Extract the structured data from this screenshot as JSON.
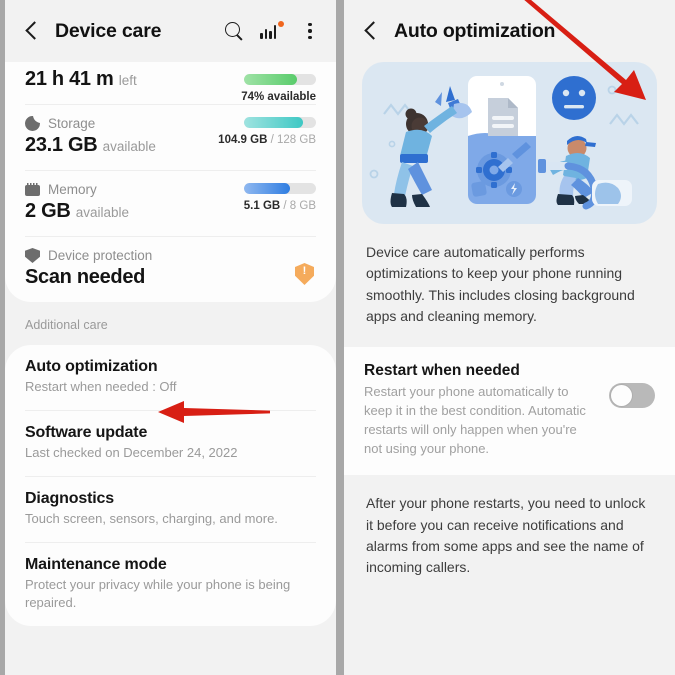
{
  "left_panel": {
    "appbar": {
      "title": "Device care",
      "back_icon": "back-chevron-icon",
      "search_icon": "search-icon",
      "chart_icon": "bar-chart-icon",
      "menu_icon": "more-options-icon"
    },
    "status_rows": [
      {
        "label": "",
        "icon": "battery-icon",
        "value": "21 h 41 m",
        "suffix": "left",
        "meter_text_main": "74% available",
        "meter_text_dim": "",
        "percent": 74,
        "color_from": "#9fe2a6",
        "color_to": "#59cc6b"
      },
      {
        "label": "Storage",
        "icon": "pie-chart-icon",
        "value": "23.1 GB",
        "suffix": "available",
        "meter_text_main": "104.9 GB",
        "meter_text_dim": " / 128 GB",
        "percent": 82,
        "color_from": "#9fe3e0",
        "color_to": "#3ec8c4"
      },
      {
        "label": "Memory",
        "icon": "memory-chip-icon",
        "value": "2 GB",
        "suffix": "available",
        "meter_text_main": "5.1 GB",
        "meter_text_dim": " / 8 GB",
        "percent": 64,
        "color_from": "#8fb8f0",
        "color_to": "#2f7de1"
      },
      {
        "label": "Device protection",
        "icon": "shield-icon",
        "value": "Scan needed",
        "suffix": "",
        "badge_icon": "warning-shield-icon"
      }
    ],
    "section_label": "Additional care",
    "list_rows": [
      {
        "title": "Auto optimization",
        "subtitle": "Restart when needed : Off"
      },
      {
        "title": "Software update",
        "subtitle": "Last checked on December 24, 2022"
      },
      {
        "title": "Diagnostics",
        "subtitle": "Touch screen, sensors, charging, and more."
      },
      {
        "title": "Maintenance mode",
        "subtitle": "Protect your privacy while your phone is being repaired."
      }
    ]
  },
  "right_panel": {
    "appbar": {
      "title": "Auto optimization",
      "back_icon": "back-chevron-icon"
    },
    "illustration": "device-care-optimization-illustration",
    "description": "Device care automatically performs optimizations to keep your phone running smoothly. This includes closing background apps and cleaning memory.",
    "setting": {
      "title": "Restart when needed",
      "description": "Restart your phone automatically to keep it in the best condition. Automatic restarts will only happen when you're not using your phone.",
      "toggle_state": "off"
    },
    "footer": "After your phone restarts, you need to unlock it before you can receive notifications and alarms from some apps and see the name of incoming callers."
  },
  "annotations": {
    "arrow_color": "#d81f14",
    "arrow_left": "arrow-pointing-to-auto-optimization",
    "arrow_right": "arrow-pointing-to-restart-toggle"
  }
}
